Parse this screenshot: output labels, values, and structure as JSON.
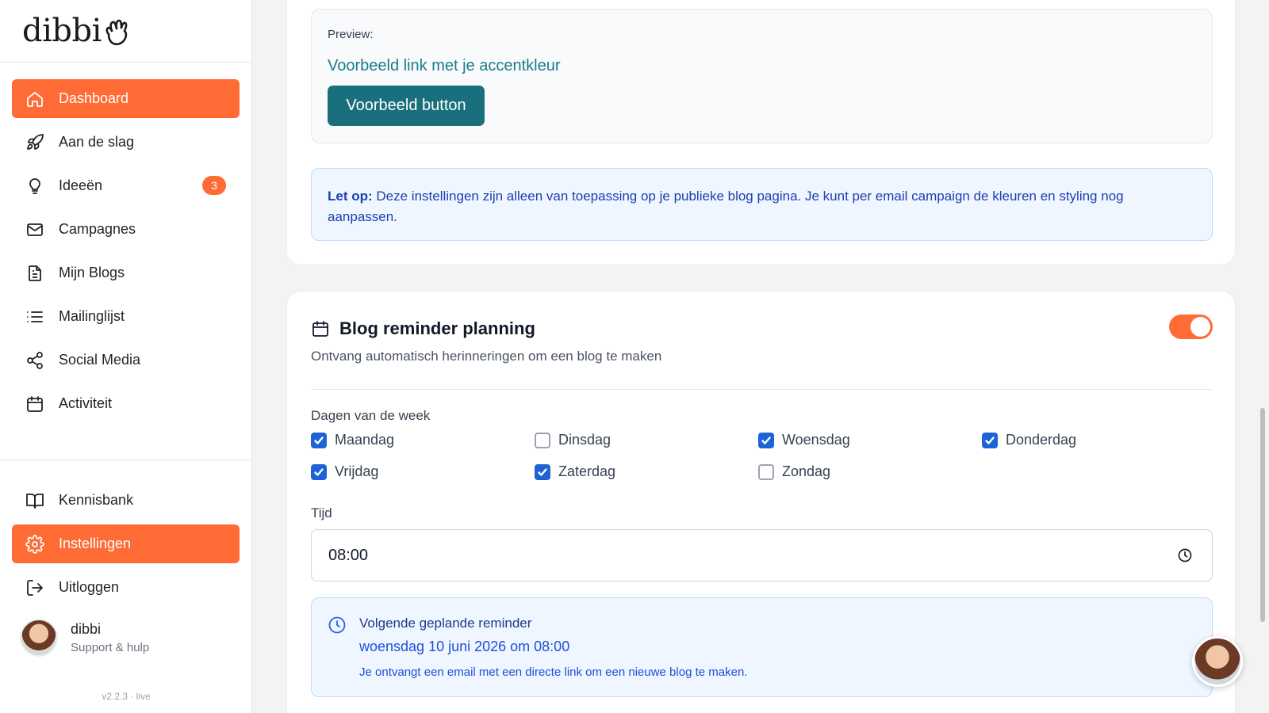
{
  "brand": {
    "name": "dibbi",
    "accent": "#ff6b35"
  },
  "sidebar": {
    "items": [
      {
        "label": "Dashboard",
        "icon": "home-icon",
        "active": true
      },
      {
        "label": "Aan de slag",
        "icon": "rocket-icon"
      },
      {
        "label": "Ideeën",
        "icon": "lightbulb-icon",
        "badge": "3"
      },
      {
        "label": "Campagnes",
        "icon": "mail-icon"
      },
      {
        "label": "Mijn Blogs",
        "icon": "document-icon"
      },
      {
        "label": "Mailinglijst",
        "icon": "list-icon"
      },
      {
        "label": "Social Media",
        "icon": "share-icon"
      },
      {
        "label": "Activiteit",
        "icon": "calendar-icon"
      }
    ],
    "bottom_items": [
      {
        "label": "Kennisbank",
        "icon": "book-icon"
      },
      {
        "label": "Instellingen",
        "icon": "gear-icon",
        "active": true
      },
      {
        "label": "Uitloggen",
        "icon": "logout-icon"
      }
    ],
    "user": {
      "name": "dibbi",
      "subtitle": "Support & hulp"
    },
    "version": "v2.2.3 · live"
  },
  "preview": {
    "label": "Preview:",
    "link_text": "Voorbeeld link met je accentkleur",
    "button_label": "Voorbeeld button",
    "accent_color": "#1a6f7c"
  },
  "note": {
    "prefix": "Let op:",
    "text": " Deze instellingen zijn alleen van toepassing op je publieke blog pagina. Je kunt per email campaign de kleuren en styling nog aanpassen."
  },
  "reminder_section": {
    "title": "Blog reminder planning",
    "subtitle": "Ontvang automatisch herinneringen om een blog te maken",
    "enabled": true,
    "days_label": "Dagen van de week",
    "days": [
      {
        "label": "Maandag",
        "checked": true
      },
      {
        "label": "Dinsdag",
        "checked": false
      },
      {
        "label": "Woensdag",
        "checked": true
      },
      {
        "label": "Donderdag",
        "checked": true
      },
      {
        "label": "Vrijdag",
        "checked": true
      },
      {
        "label": "Zaterdag",
        "checked": true
      },
      {
        "label": "Zondag",
        "checked": false
      }
    ],
    "time_label": "Tijd",
    "time_value": "08:00",
    "next": {
      "title": "Volgende geplande reminder",
      "date": "woensdag 10 juni 2026 om 08:00",
      "description": "Je ontvangt een email met een directe link om een nieuwe blog te maken."
    }
  }
}
